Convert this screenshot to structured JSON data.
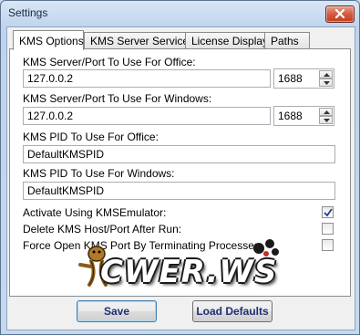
{
  "window": {
    "title": "Settings"
  },
  "tabs": [
    "KMS Options",
    "KMS Server Service",
    "License Display",
    "Paths"
  ],
  "kms_options": {
    "office_server_label": "KMS Server/Port To Use For Office:",
    "office_server_value": "127.0.0.2",
    "office_port_value": "1688",
    "windows_server_label": "KMS Server/Port To Use For Windows:",
    "windows_server_value": "127.0.0.2",
    "windows_port_value": "1688",
    "office_pid_label": "KMS PID To Use For Office:",
    "office_pid_value": "DefaultKMSPID",
    "windows_pid_label": "KMS PID To Use For Windows:",
    "windows_pid_value": "DefaultKMSPID",
    "checkboxes": [
      {
        "label": "Activate Using KMSEmulator:",
        "checked": true
      },
      {
        "label": "Delete KMS Host/Port After Run:",
        "checked": false
      },
      {
        "label": "Force Open KMS Port By Terminating Processes",
        "checked": false
      }
    ]
  },
  "buttons": {
    "save": "Save",
    "load_defaults": "Load Defaults"
  },
  "watermark": {
    "text": "CWER.WS"
  }
}
